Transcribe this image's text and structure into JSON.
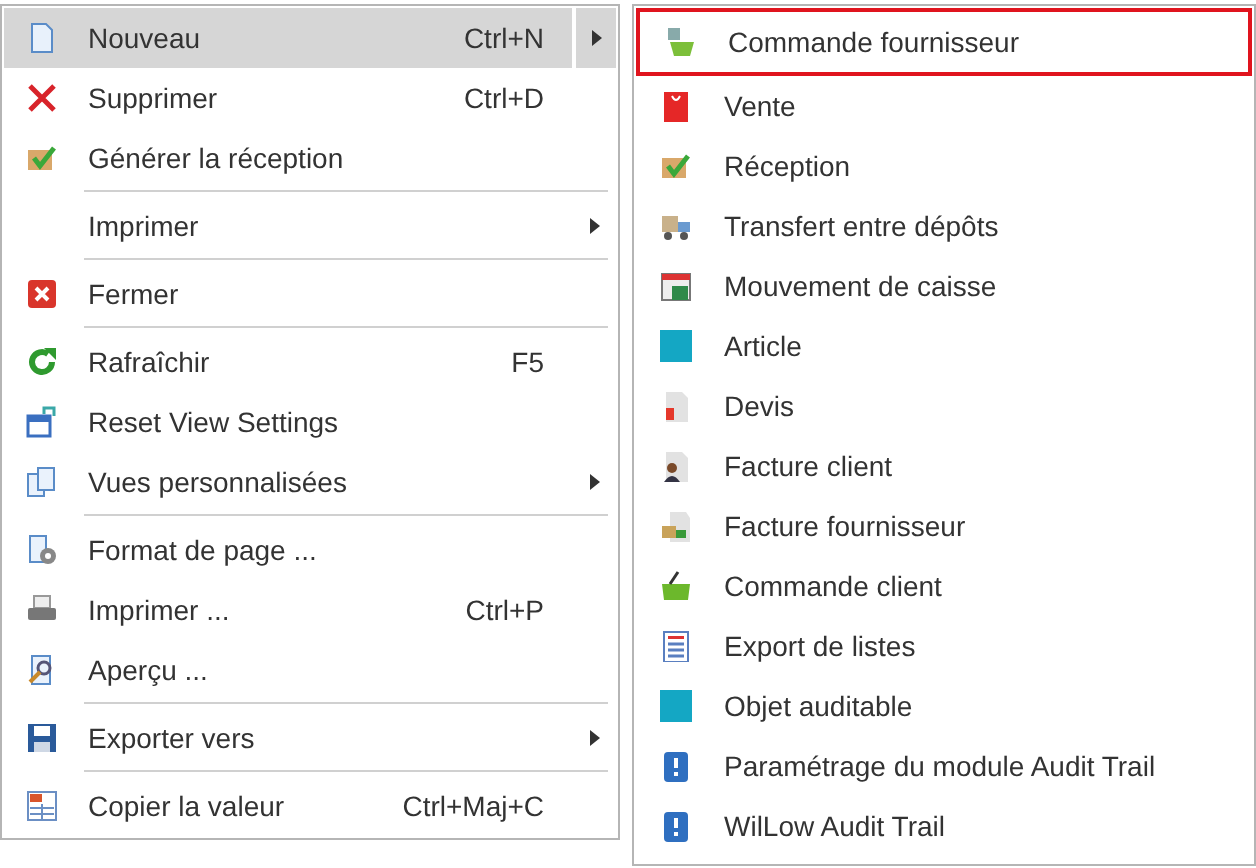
{
  "context_menu": {
    "items": [
      {
        "kind": "item",
        "label": "Nouveau",
        "shortcut": "Ctrl+N",
        "submenu": true,
        "selected": true
      },
      {
        "kind": "item",
        "label": "Supprimer",
        "shortcut": "Ctrl+D",
        "submenu": false,
        "selected": false
      },
      {
        "kind": "item",
        "label": "Générer la réception",
        "submenu": false,
        "selected": false
      },
      {
        "kind": "separator"
      },
      {
        "kind": "item",
        "label": "Imprimer",
        "submenu": true,
        "selected": false
      },
      {
        "kind": "separator"
      },
      {
        "kind": "item",
        "label": "Fermer",
        "submenu": false,
        "selected": false
      },
      {
        "kind": "separator"
      },
      {
        "kind": "item",
        "label": "Rafraîchir",
        "shortcut": "F5",
        "submenu": false,
        "selected": false
      },
      {
        "kind": "item",
        "label": "Reset View Settings",
        "submenu": false,
        "selected": false
      },
      {
        "kind": "item",
        "label": "Vues personnalisées",
        "submenu": true,
        "selected": false
      },
      {
        "kind": "separator"
      },
      {
        "kind": "item",
        "label": "Format de page ...",
        "submenu": false,
        "selected": false
      },
      {
        "kind": "item",
        "label": "Imprimer ...",
        "shortcut": "Ctrl+P",
        "submenu": false,
        "selected": false
      },
      {
        "kind": "item",
        "label": "Aperçu ...",
        "submenu": false,
        "selected": false
      },
      {
        "kind": "separator"
      },
      {
        "kind": "item",
        "label": "Exporter vers",
        "submenu": true,
        "selected": false
      },
      {
        "kind": "separator"
      },
      {
        "kind": "item",
        "label": "Copier la valeur",
        "shortcut": "Ctrl+Maj+C",
        "submenu": false,
        "selected": false
      }
    ]
  },
  "submenu": {
    "items": [
      {
        "label": "Commande fournisseur",
        "selected": true
      },
      {
        "label": "Vente",
        "selected": false
      },
      {
        "label": "Réception",
        "selected": false
      },
      {
        "label": "Transfert entre dépôts",
        "selected": false
      },
      {
        "label": "Mouvement de caisse",
        "selected": false
      },
      {
        "label": "Article",
        "selected": false
      },
      {
        "label": "Devis",
        "selected": false
      },
      {
        "label": "Facture client",
        "selected": false
      },
      {
        "label": "Facture fournisseur",
        "selected": false
      },
      {
        "label": "Commande client",
        "selected": false
      },
      {
        "label": "Export de listes",
        "selected": false
      },
      {
        "label": "Objet auditable",
        "selected": false
      },
      {
        "label": "Paramétrage du module Audit Trail",
        "selected": false
      },
      {
        "label": "WilLow Audit Trail",
        "selected": false
      }
    ]
  }
}
